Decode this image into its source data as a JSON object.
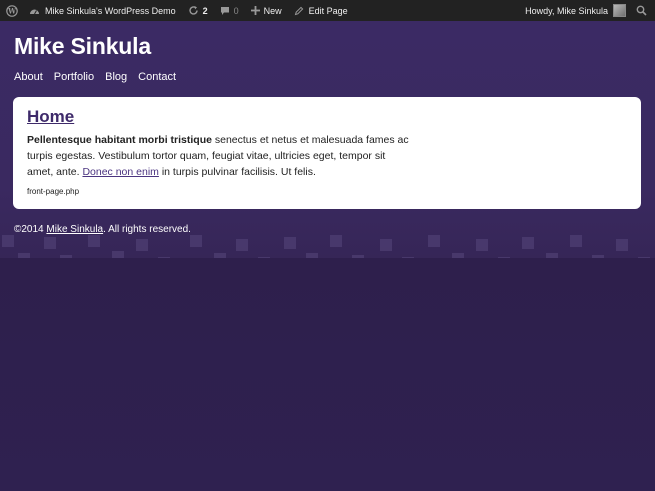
{
  "adminbar": {
    "site_name": "Mike Sinkula's WordPress Demo",
    "updates_count": "2",
    "comments_count": "0",
    "new_label": "New",
    "edit_label": "Edit Page",
    "howdy": "Howdy, Mike Sinkula"
  },
  "site": {
    "title": "Mike Sinkula"
  },
  "nav": {
    "items": [
      "About",
      "Portfolio",
      "Blog",
      "Contact"
    ]
  },
  "content": {
    "heading": "Home",
    "bold_text": "Pellentesque habitant morbi tristique",
    "text_1": " senectus et netus et malesuada fames ac turpis egestas. Vestibulum tortor quam, feugiat vitae, ultricies eget, tempor sit amet, ante. ",
    "link_text": "Donec non enim",
    "text_2": " in turpis pulvinar facilisis. Ut felis.",
    "template_name": "front-page.php"
  },
  "footer": {
    "copyright_prefix": "©2014 ",
    "author_link": "Mike Sinkula",
    "suffix": ". All rights reserved."
  },
  "colors": {
    "background": "#30214f",
    "band": "#3a2960",
    "adminbar": "#222222",
    "heading": "#3e2a6a",
    "link": "#4b3480"
  }
}
